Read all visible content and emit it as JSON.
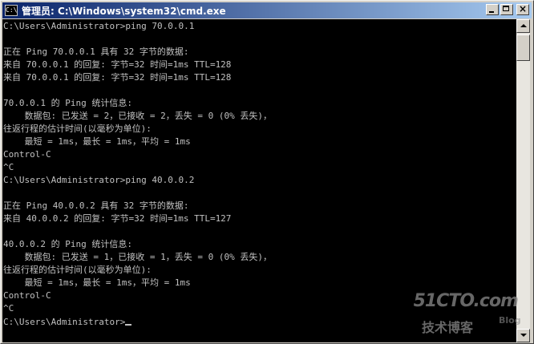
{
  "window": {
    "title": "管理员: C:\\Windows\\system32\\cmd.exe",
    "icon": "cmd-icon",
    "controls": [
      "minimize",
      "maximize",
      "close"
    ],
    "close_label": "×"
  },
  "console": {
    "lines": [
      "C:\\Users\\Administrator>ping 70.0.0.1",
      "",
      "正在 Ping 70.0.0.1 具有 32 字节的数据:",
      "来自 70.0.0.1 的回复: 字节=32 时间=1ms TTL=128",
      "来自 70.0.0.1 的回复: 字节=32 时间=1ms TTL=128",
      "",
      "70.0.0.1 的 Ping 统计信息:",
      "    数据包: 已发送 = 2，已接收 = 2，丢失 = 0 (0% 丢失)，",
      "往返行程的估计时间(以毫秒为单位):",
      "    最短 = 1ms，最长 = 1ms，平均 = 1ms",
      "Control-C",
      "^C",
      "C:\\Users\\Administrator>ping 40.0.0.2",
      "",
      "正在 Ping 40.0.0.2 具有 32 字节的数据:",
      "来自 40.0.0.2 的回复: 字节=32 时间=1ms TTL=127",
      "",
      "40.0.0.2 的 Ping 统计信息:",
      "    数据包: 已发送 = 1，已接收 = 1，丢失 = 0 (0% 丢失)，",
      "往返行程的估计时间(以毫秒为单位):",
      "    最短 = 1ms，最长 = 1ms，平均 = 1ms",
      "Control-C",
      "^C"
    ],
    "prompt": "C:\\Users\\Administrator>"
  },
  "watermark": {
    "site": "51CTO.com",
    "subtitle": "技术博客",
    "blog": "Blog"
  },
  "colors": {
    "console_bg": "#000000",
    "console_fg": "#c0c0c0",
    "titlebar_start": "#0a246a",
    "titlebar_end": "#a6caf0"
  }
}
